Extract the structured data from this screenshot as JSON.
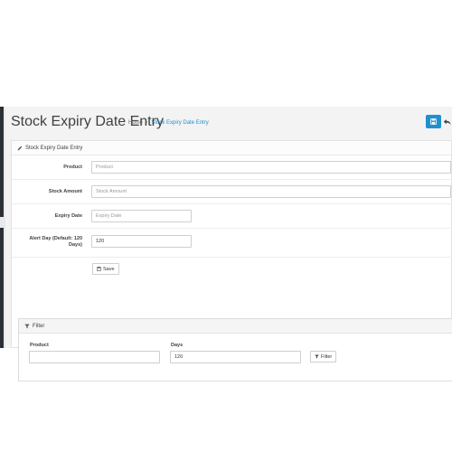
{
  "header": {
    "title": "Stock Expiry Date Entry",
    "breadcrumb": [
      "Home",
      "Stock Expiry Date Entry"
    ],
    "breadcrumb_sep": "›"
  },
  "panel": {
    "heading": "Stock Expiry Date Entry",
    "fields": [
      {
        "label": "Product",
        "placeholder": "Product",
        "value": ""
      },
      {
        "label": "Stock Amount",
        "placeholder": "Stock Amount",
        "value": ""
      },
      {
        "label": "Expiry Date",
        "placeholder": "Expiry Date",
        "value": ""
      },
      {
        "label_line1": "Alert Day (Default: 120",
        "label_line2": "Days)",
        "placeholder": "",
        "value": "120"
      }
    ],
    "save_label": "Save"
  },
  "filter": {
    "heading": "Filter",
    "product_label": "Product",
    "product_value": "",
    "days_label": "Days",
    "days_value": "120",
    "button_label": "Filter"
  },
  "colors": {
    "accent": "#1e91cf",
    "sidebar": "#2b3036"
  },
  "icons": {
    "save_top": "save-icon",
    "back_top": "reply-icon",
    "panel_head": "pencil-icon",
    "save_button": "floppy-icon",
    "filter": "funnel-icon"
  }
}
